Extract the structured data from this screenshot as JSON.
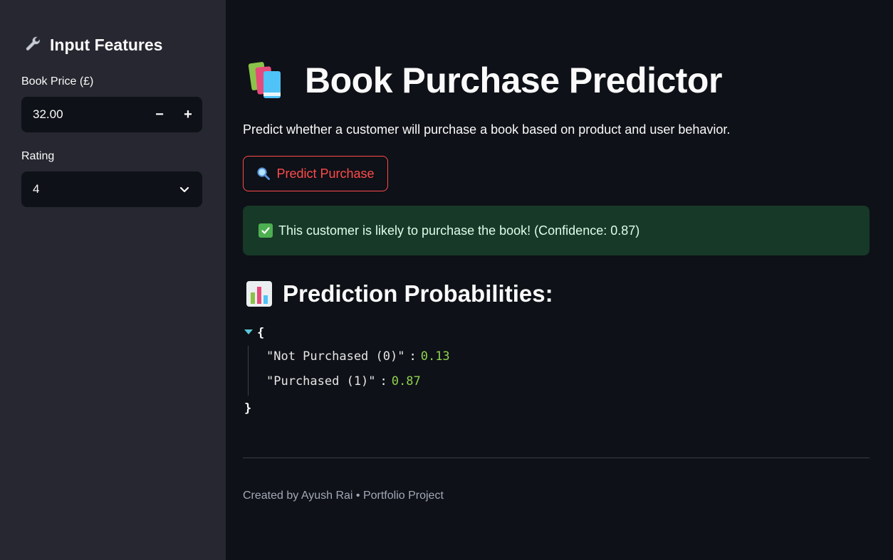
{
  "sidebar": {
    "title_icon": "wrench-icon",
    "title": "Input Features",
    "price": {
      "label": "Book Price (£)",
      "value": "32.00",
      "decrement": "−",
      "increment": "+"
    },
    "rating": {
      "label": "Rating",
      "value": "4"
    }
  },
  "main": {
    "title_icon": "books-icon",
    "title": "Book Purchase Predictor",
    "subtitle": "Predict whether a customer will purchase a book based on product and user behavior.",
    "predict_button": {
      "icon": "magnifier-icon",
      "label": "Predict Purchase"
    },
    "success_alert": {
      "icon": "check-box-icon",
      "text": "This customer is likely to purchase the book! (Confidence: 0.87)"
    },
    "probabilities_heading": {
      "icon": "bar-chart-icon",
      "text": "Prediction Probabilities:"
    },
    "json_view": {
      "open": "{",
      "close": "}",
      "entries": [
        {
          "key": "\"Not Purchased (0)\"",
          "value": "0.13"
        },
        {
          "key": "\"Purchased (1)\"",
          "value": "0.87"
        }
      ]
    },
    "footer": "Created by Ayush Rai • Portfolio Project"
  },
  "colors": {
    "background": "#0e1117",
    "sidebar": "#262730",
    "accent": "#ff4b4b",
    "success_bg": "#173928",
    "json_number": "#8fd14f"
  }
}
